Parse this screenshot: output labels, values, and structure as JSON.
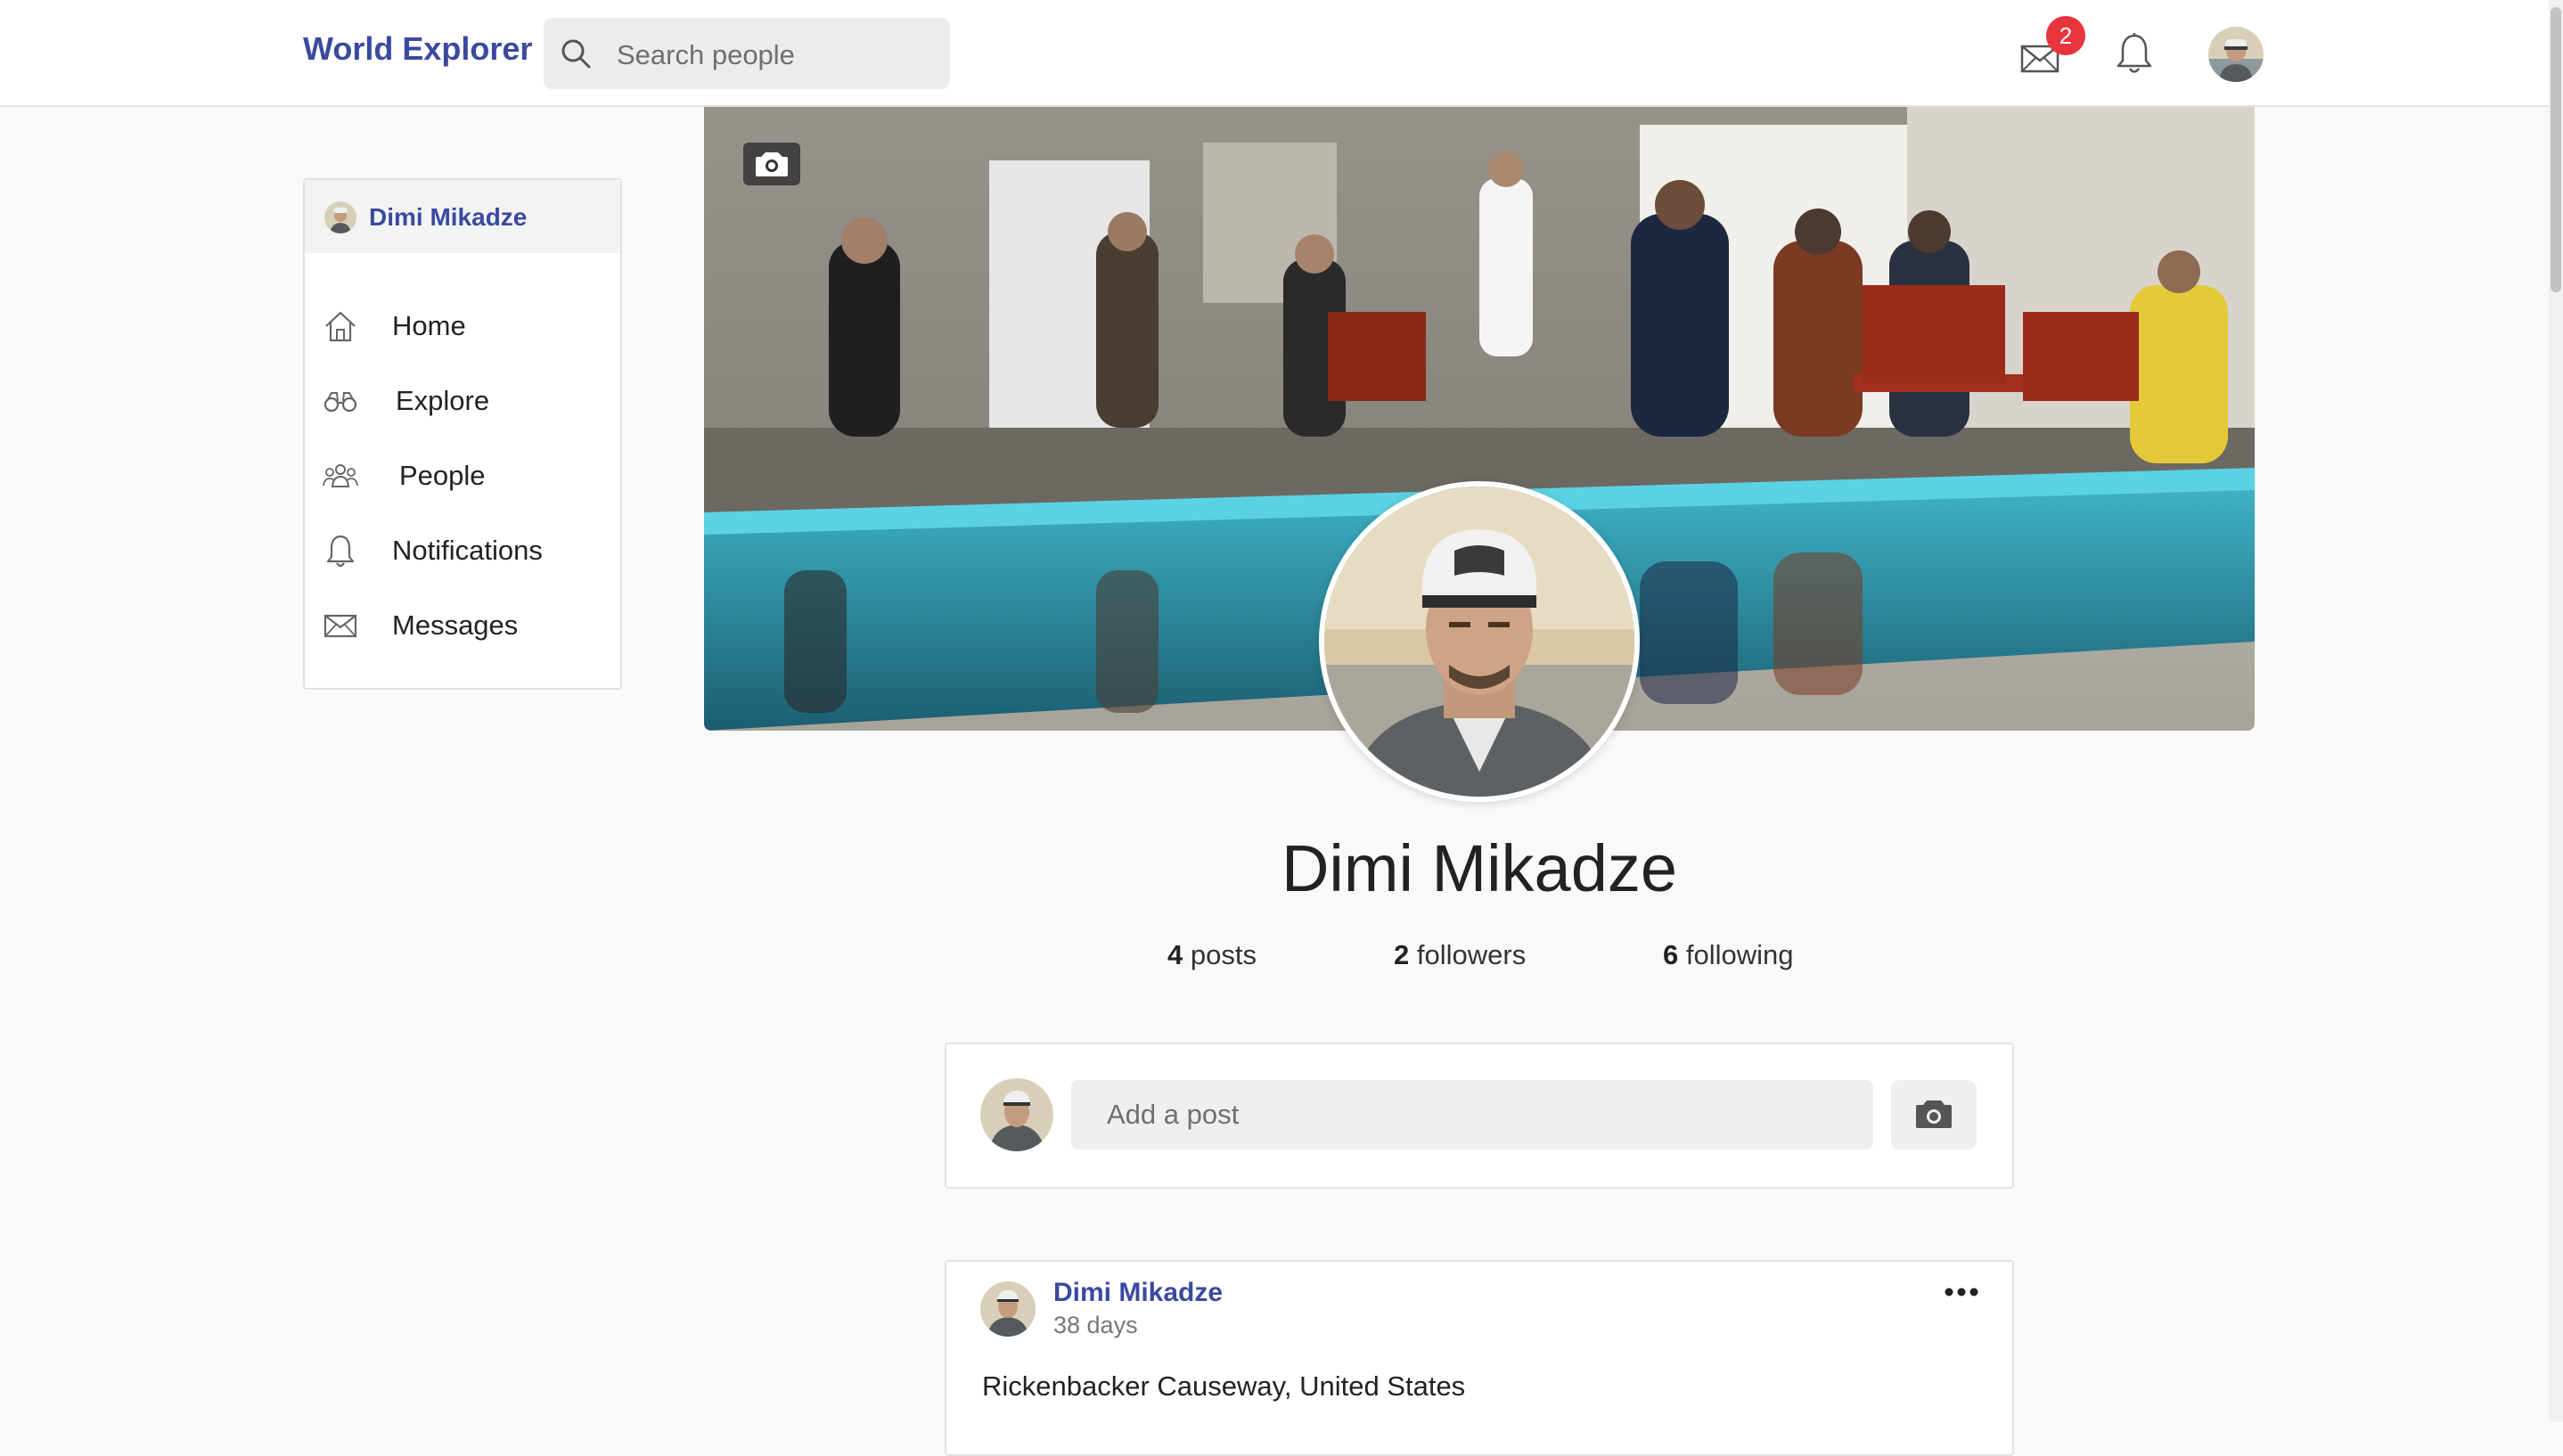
{
  "header": {
    "brand": "World Explorer",
    "search": {
      "placeholder": "Search people"
    },
    "messages_badge": "2"
  },
  "sidebar": {
    "user_name": "Dimi Mikadze",
    "items": [
      {
        "label": "Home",
        "icon": "home-icon"
      },
      {
        "label": "Explore",
        "icon": "binoculars-icon"
      },
      {
        "label": "People",
        "icon": "people-icon"
      },
      {
        "label": "Notifications",
        "icon": "bell-icon"
      },
      {
        "label": "Messages",
        "icon": "envelope-icon"
      }
    ]
  },
  "profile": {
    "name": "Dimi Mikadze",
    "stats": {
      "posts_count": "4",
      "posts_label": "posts",
      "followers_count": "2",
      "followers_label": "followers",
      "following_count": "6",
      "following_label": "following"
    }
  },
  "composer": {
    "placeholder": "Add a post"
  },
  "posts": [
    {
      "author": "Dimi Mikadze",
      "time": "38 days",
      "text": "Rickenbacker Causeway, United States"
    }
  ],
  "colors": {
    "accent": "#3a4aa0",
    "badge": "#e8343c",
    "background": "#f9f9fb"
  }
}
